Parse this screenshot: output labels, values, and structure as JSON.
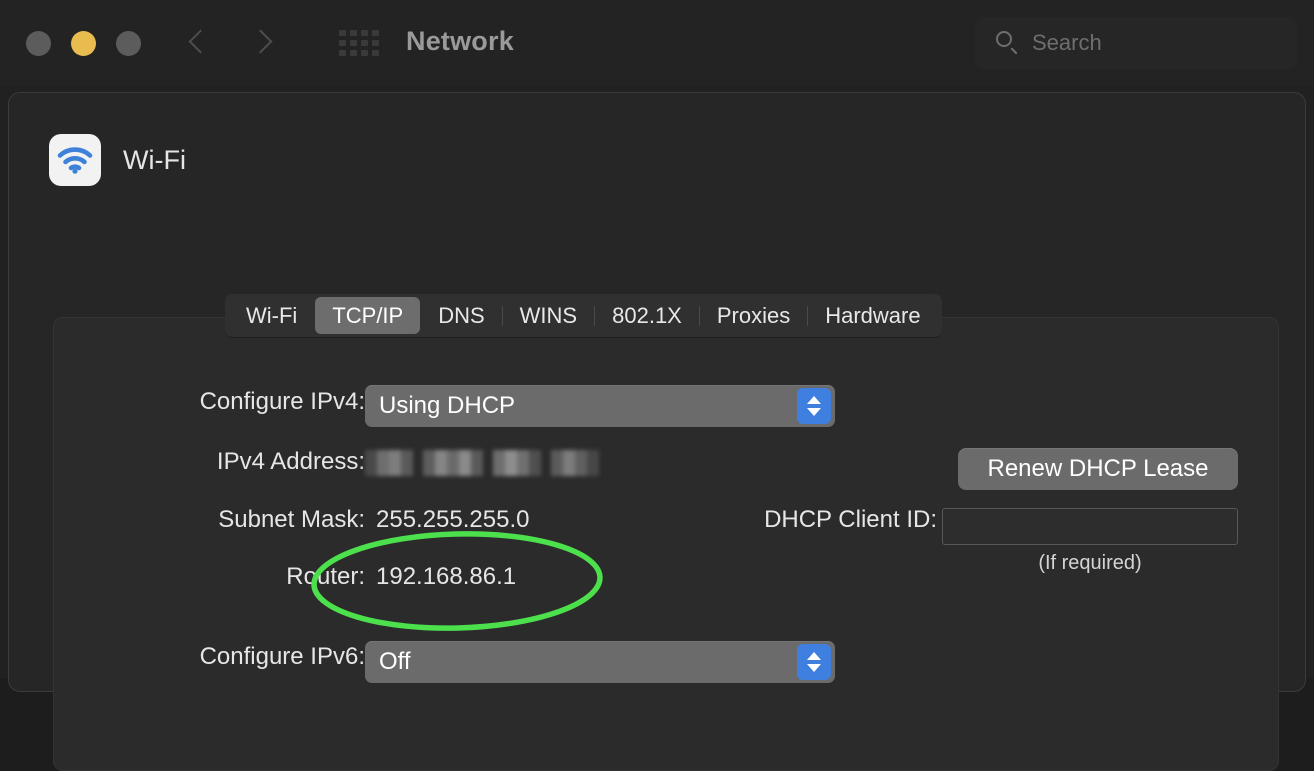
{
  "window": {
    "title": "Network",
    "traffic_lights": [
      "close",
      "minimize",
      "zoom"
    ],
    "nav_back_icon": "chevron-left-icon",
    "nav_forward_icon": "chevron-right-icon",
    "show_all_icon": "grid-icon"
  },
  "search": {
    "placeholder": "Search",
    "icon": "search-icon",
    "value": ""
  },
  "service": {
    "name": "Wi-Fi",
    "icon": "wifi-icon"
  },
  "tabs": [
    {
      "label": "Wi-Fi",
      "selected": false
    },
    {
      "label": "TCP/IP",
      "selected": true
    },
    {
      "label": "DNS",
      "selected": false
    },
    {
      "label": "WINS",
      "selected": false
    },
    {
      "label": "802.1X",
      "selected": false
    },
    {
      "label": "Proxies",
      "selected": false
    },
    {
      "label": "Hardware",
      "selected": false
    }
  ],
  "form": {
    "configure_ipv4": {
      "label": "Configure IPv4:",
      "value": "Using DHCP",
      "stepper_icon": "chevron-up-down-icon"
    },
    "ipv4_address": {
      "label": "IPv4 Address:",
      "value": "",
      "redacted": true
    },
    "subnet_mask": {
      "label": "Subnet Mask:",
      "value": "255.255.255.0"
    },
    "router": {
      "label": "Router:",
      "value": "192.168.86.1"
    },
    "configure_ipv6": {
      "label": "Configure IPv6:",
      "value": "Off",
      "stepper_icon": "chevron-up-down-icon"
    },
    "renew_lease_button": {
      "label": "Renew DHCP Lease"
    },
    "dhcp_client_id": {
      "label": "DHCP Client ID:",
      "value": "",
      "hint": "(If required)"
    }
  },
  "annotation": {
    "type": "ellipse-highlight",
    "target": "router-row",
    "color": "#4ce04c"
  },
  "colors": {
    "window_bg": "#212121",
    "titlebar_bg": "#232323",
    "panel_bg": "#262626",
    "content_bg": "#2b2b2b",
    "control_gray": "#6b6b6b",
    "accent_blue": "#3f7fe0",
    "annotation_green": "#4ce04c",
    "wifi_blue": "#3d82d8",
    "minimize_yellow": "#e8bc4f"
  }
}
